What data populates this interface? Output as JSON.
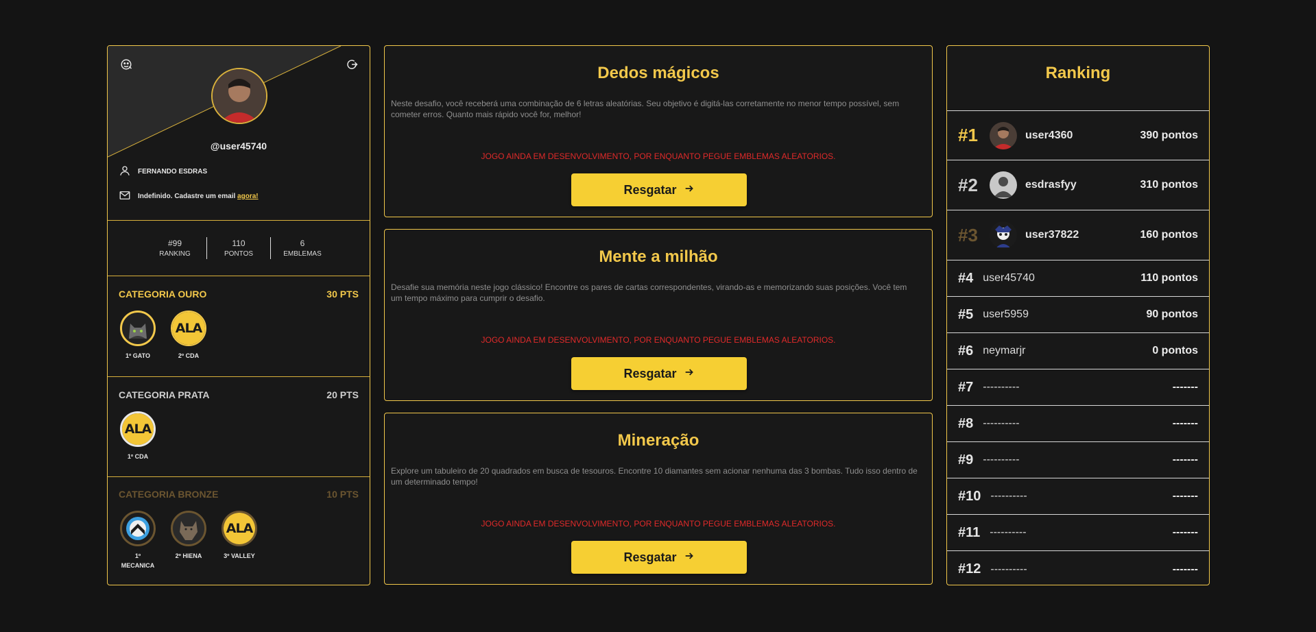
{
  "profile": {
    "username": "@user45740",
    "full_name": "FERNANDO ESDRAS",
    "email_text": "Indefinido. Cadastre um email",
    "email_link": "agora!",
    "stats": [
      {
        "value": "#99",
        "label": "RANKING"
      },
      {
        "value": "110",
        "label": "PONTOS"
      },
      {
        "value": "6",
        "label": "EMBLEMAS"
      }
    ],
    "categories": [
      {
        "name": "CATEGORIA OURO",
        "points": "30 PTS",
        "color": "#f2c84b",
        "badges": [
          {
            "label": "1º GATO"
          },
          {
            "label": "2º CDA"
          }
        ]
      },
      {
        "name": "CATEGORIA PRATA",
        "points": "20 PTS",
        "color": "#cfcfcf",
        "badges": [
          {
            "label": "1º CDA"
          }
        ]
      },
      {
        "name": "CATEGORIA BRONZE",
        "points": "10 PTS",
        "color": "#6b5530",
        "badges": [
          {
            "label": "1º MECANICA"
          },
          {
            "label": "2º HIENA"
          },
          {
            "label": "3º VALLEY"
          }
        ]
      }
    ]
  },
  "games": [
    {
      "title": "Dedos mágicos",
      "description": "Neste desafio, você receberá uma combinação de 6 letras aleatórias. Seu objetivo é digitá-las corretamente no menor tempo possível, sem cometer erros. Quanto mais rápido você for, melhor!",
      "warning": "JOGO AINDA EM DESENVOLVIMENTO, POR ENQUANTO PEGUE EMBLEMAS ALEATORIOS.",
      "button": "Resgatar"
    },
    {
      "title": "Mente a milhão",
      "description": "Desafie sua memória neste jogo clássico! Encontre os pares de cartas correspondentes, virando-as e memorizando suas posições. Você tem um tempo máximo para cumprir o desafio.",
      "warning": "JOGO AINDA EM DESENVOLVIMENTO, POR ENQUANTO PEGUE EMBLEMAS ALEATORIOS.",
      "button": "Resgatar"
    },
    {
      "title": "Mineração",
      "description": "Explore um tabuleiro de 20 quadrados em busca de tesouros. Encontre 10 diamantes sem acionar nenhuma das 3 bombas. Tudo isso dentro de um determinado tempo!",
      "warning": "JOGO AINDA EM DESENVOLVIMENTO, POR ENQUANTO PEGUE EMBLEMAS ALEATORIOS.",
      "button": "Resgatar"
    }
  ],
  "ranking": {
    "title": "Ranking",
    "entries": [
      {
        "pos": "#1",
        "name": "user4360",
        "points": "390 pontos",
        "color": "#f2c84b"
      },
      {
        "pos": "#2",
        "name": "esdrasfyy",
        "points": "310 pontos",
        "color": "#cfcfcf"
      },
      {
        "pos": "#3",
        "name": "user37822",
        "points": "160 pontos",
        "color": "#6b5530"
      },
      {
        "pos": "#4",
        "name": "user45740",
        "points": "110 pontos"
      },
      {
        "pos": "#5",
        "name": "user5959",
        "points": "90 pontos"
      },
      {
        "pos": "#6",
        "name": "neymarjr",
        "points": "0 pontos"
      },
      {
        "pos": "#7",
        "name": "----------",
        "points": "-------"
      },
      {
        "pos": "#8",
        "name": "----------",
        "points": "-------"
      },
      {
        "pos": "#9",
        "name": "----------",
        "points": "-------"
      },
      {
        "pos": "#10",
        "name": "----------",
        "points": "-------"
      },
      {
        "pos": "#11",
        "name": "----------",
        "points": "-------"
      },
      {
        "pos": "#12",
        "name": "----------",
        "points": "-------"
      }
    ]
  }
}
